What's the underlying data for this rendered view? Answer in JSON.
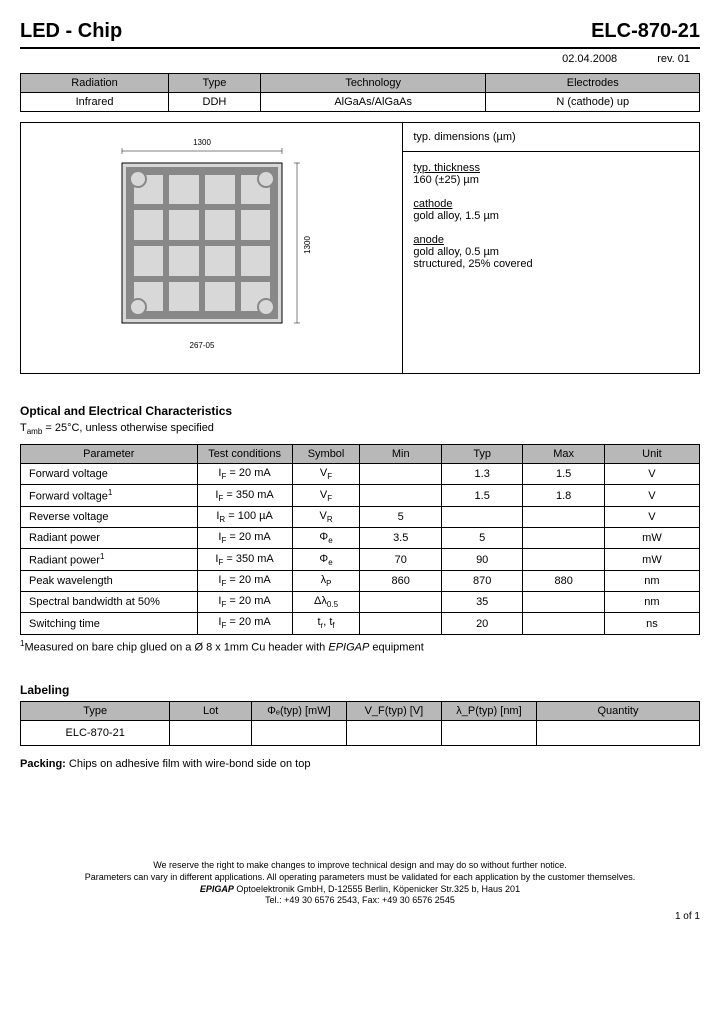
{
  "header": {
    "left": "LED - Chip",
    "right": "ELC-870-21",
    "date": "02.04.2008",
    "rev": "rev. 01"
  },
  "t1": {
    "h": [
      "Radiation",
      "Type",
      "Technology",
      "Electrodes"
    ],
    "r": [
      "Infrared",
      "DDH",
      "AlGaAs/AlGaAs",
      "N (cathode) up"
    ]
  },
  "dims": {
    "title": "typ. dimensions (µm)",
    "thickness_lbl": "typ. thickness",
    "thickness": "160 (±25) µm",
    "cathode_lbl": "cathode",
    "cathode": "gold alloy, 1.5 µm",
    "anode_lbl": "anode",
    "anode1": "gold alloy, 0.5 µm",
    "anode2": "structured, 25% covered"
  },
  "diagram": {
    "top_dim": "1300",
    "right_dim": "1300",
    "bottom_label": "267-05"
  },
  "opt": {
    "title": "Optical and Electrical Characteristics",
    "cond": "T",
    "cond2": " = 25°C, unless otherwise specified",
    "h": [
      "Parameter",
      "Test conditions",
      "Symbol",
      "Min",
      "Typ",
      "Max",
      "Unit"
    ],
    "rows": [
      {
        "p": "Forward voltage",
        "tc": "I",
        "tcsub": "F",
        "tcval": " = 20 mA",
        "s": "V",
        "ssub": "F",
        "min": "",
        "typ": "1.3",
        "max": "1.5",
        "u": "V"
      },
      {
        "p": "Forward voltage",
        "psup": "1",
        "tc": "I",
        "tcsub": "F",
        "tcval": " = 350 mA",
        "s": "V",
        "ssub": "F",
        "min": "",
        "typ": "1.5",
        "max": "1.8",
        "u": "V"
      },
      {
        "p": "Reverse voltage",
        "tc": "I",
        "tcsub": "R",
        "tcval": " = 100 µA",
        "s": "V",
        "ssub": "R",
        "min": "5",
        "typ": "",
        "max": "",
        "u": "V"
      },
      {
        "p": "Radiant power",
        "tc": "I",
        "tcsub": "F",
        "tcval": " = 20 mA",
        "s": "Φ",
        "ssub": "e",
        "min": "3.5",
        "typ": "5",
        "max": "",
        "u": "mW"
      },
      {
        "p": "Radiant power",
        "psup": "1",
        "tc": "I",
        "tcsub": "F",
        "tcval": " = 350 mA",
        "s": "Φ",
        "ssub": "e",
        "min": "70",
        "typ": "90",
        "max": "",
        "u": "mW"
      },
      {
        "p": "Peak wavelength",
        "tc": "I",
        "tcsub": "F",
        "tcval": " = 20 mA",
        "s": "λ",
        "ssub": "P",
        "min": "860",
        "typ": "870",
        "max": "880",
        "u": "nm"
      },
      {
        "p": "Spectral bandwidth at 50%",
        "tc": "I",
        "tcsub": "F",
        "tcval": " = 20 mA",
        "s": "Δλ",
        "ssub": "0.5",
        "min": "",
        "typ": "35",
        "max": "",
        "u": "nm"
      },
      {
        "p": "Switching time",
        "tc": "I",
        "tcsub": "F",
        "tcval": " = 20 mA",
        "s": "t",
        "ssub": "r",
        "s2": ", t",
        "s2sub": "f",
        "min": "",
        "typ": "20",
        "max": "",
        "u": "ns"
      }
    ],
    "foot": "Measured on bare chip glued on a Ø 8 x 1mm Cu header with ",
    "foot_i": "EPIGAP",
    "foot2": " equipment"
  },
  "labeling": {
    "title": "Labeling",
    "h": [
      "Type",
      "Lot",
      "Φₑ(typ) [mW]",
      "V_F(typ) [V]",
      "λ_P(typ) [nm]",
      "Quantity"
    ],
    "type": "ELC-870-21"
  },
  "packing": {
    "lbl": "Packing:",
    "txt": "  Chips on adhesive film with wire-bond side on top"
  },
  "footer": {
    "l1": "We reserve the right to make changes to improve technical design and may do so without further notice.",
    "l2": "Parameters can vary in different applications. All operating parameters must be validated for each application by the customer themselves.",
    "l3": "EPIGAP",
    "l3b": " Optoelektronik GmbH, D-12555 Berlin, Köpenicker Str.325 b, Haus 201",
    "l4": "Tel.: +49 30 6576 2543, Fax: +49 30 6576 2545",
    "pg": "1 of  1"
  }
}
